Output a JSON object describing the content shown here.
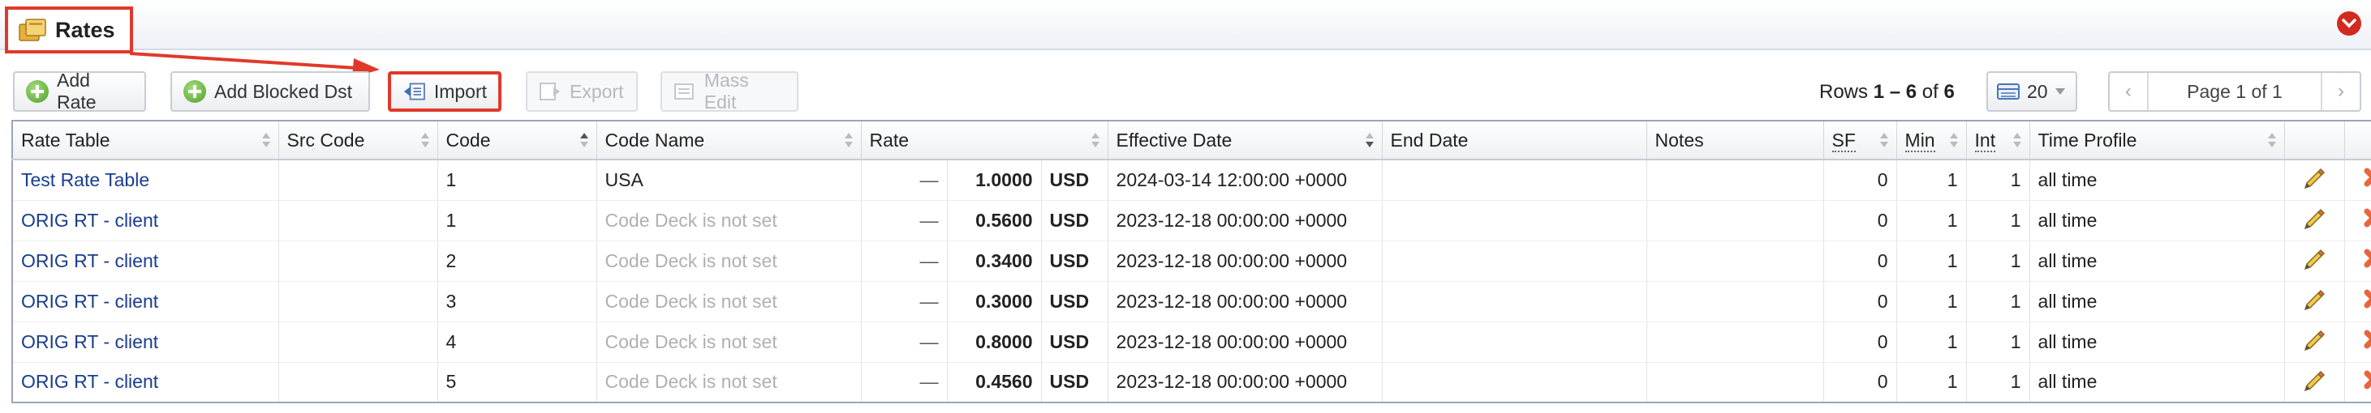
{
  "page": {
    "title": "Rates"
  },
  "toolbar": {
    "add_rate": "Add Rate",
    "add_blocked_dst": "Add Blocked Dst",
    "import": "Import",
    "export": "Export",
    "mass_edit": "Mass Edit"
  },
  "pagination": {
    "rows_label": "Rows",
    "range": "1 – 6",
    "of_label": "of",
    "total": "6",
    "per_page": "20",
    "page_label": "Page 1 of 1",
    "prev": "‹",
    "next": "›"
  },
  "table": {
    "columns": [
      "Rate Table",
      "Src Code",
      "Code",
      "Code Name",
      "Rate",
      "Effective Date",
      "End Date",
      "Notes",
      "SF",
      "Min",
      "Int",
      "Time Profile"
    ],
    "rows": [
      {
        "rate_table": "Test Rate Table",
        "src_code": "",
        "code": "1",
        "code_name": "USA",
        "code_name_muted": false,
        "dash": "—",
        "rate": "1.0000",
        "currency": "USD",
        "effective_date": "2024-03-14 12:00:00 +0000",
        "end_date": "",
        "notes": "",
        "sf": "0",
        "min": "1",
        "int": "1",
        "time_profile": "all time"
      },
      {
        "rate_table": "ORIG RT - client",
        "src_code": "",
        "code": "1",
        "code_name": "Code Deck is not set",
        "code_name_muted": true,
        "dash": "—",
        "rate": "0.5600",
        "currency": "USD",
        "effective_date": "2023-12-18 00:00:00 +0000",
        "end_date": "",
        "notes": "",
        "sf": "0",
        "min": "1",
        "int": "1",
        "time_profile": "all time"
      },
      {
        "rate_table": "ORIG RT - client",
        "src_code": "",
        "code": "2",
        "code_name": "Code Deck is not set",
        "code_name_muted": true,
        "dash": "—",
        "rate": "0.3400",
        "currency": "USD",
        "effective_date": "2023-12-18 00:00:00 +0000",
        "end_date": "",
        "notes": "",
        "sf": "0",
        "min": "1",
        "int": "1",
        "time_profile": "all time"
      },
      {
        "rate_table": "ORIG RT - client",
        "src_code": "",
        "code": "3",
        "code_name": "Code Deck is not set",
        "code_name_muted": true,
        "dash": "—",
        "rate": "0.3000",
        "currency": "USD",
        "effective_date": "2023-12-18 00:00:00 +0000",
        "end_date": "",
        "notes": "",
        "sf": "0",
        "min": "1",
        "int": "1",
        "time_profile": "all time"
      },
      {
        "rate_table": "ORIG RT - client",
        "src_code": "",
        "code": "4",
        "code_name": "Code Deck is not set",
        "code_name_muted": true,
        "dash": "—",
        "rate": "0.8000",
        "currency": "USD",
        "effective_date": "2023-12-18 00:00:00 +0000",
        "end_date": "",
        "notes": "",
        "sf": "0",
        "min": "1",
        "int": "1",
        "time_profile": "all time"
      },
      {
        "rate_table": "ORIG RT - client",
        "src_code": "",
        "code": "5",
        "code_name": "Code Deck is not set",
        "code_name_muted": true,
        "dash": "—",
        "rate": "0.4560",
        "currency": "USD",
        "effective_date": "2023-12-18 00:00:00 +0000",
        "end_date": "",
        "notes": "",
        "sf": "0",
        "min": "1",
        "int": "1",
        "time_profile": "all time"
      }
    ]
  },
  "icons": {
    "title": "rates-folder-icon",
    "collapse": "collapse-icon",
    "add": "plus-circle-icon",
    "import": "import-icon",
    "export": "export-icon",
    "mass_edit": "mass-edit-icon",
    "per_page": "rows-per-page-icon",
    "edit": "pencil-icon",
    "delete": "delete-x-icon"
  },
  "colors": {
    "highlight": "#e0392b",
    "link": "#1a3d8f",
    "add_icon": "#4d9e2a",
    "delete_icon": "#e8663c",
    "collapse": "#d22a1e"
  }
}
